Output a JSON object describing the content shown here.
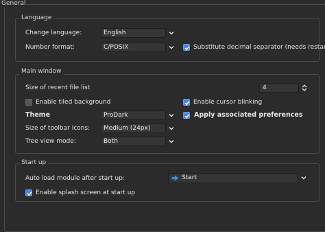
{
  "general": {
    "title": "General",
    "language_group": {
      "title": "Language",
      "change_language_label": "Change language:",
      "change_language_value": "English",
      "number_format_label": "Number format:",
      "number_format_value": "C/POSIX",
      "substitute_label": "Substitute decimal separator (needs restart)",
      "substitute_checked": true
    },
    "main_window_group": {
      "title": "Main window",
      "recent_files_label": "Size of recent file list",
      "recent_files_value": "4",
      "tiled_background_label": "Enable tiled background",
      "tiled_background_checked": false,
      "cursor_blinking_label": "Enable cursor blinking",
      "cursor_blinking_checked": true,
      "theme_label": "Theme",
      "theme_value": "ProDark",
      "associated_prefs_label": "Apply associated preferences",
      "associated_prefs_checked": true,
      "toolbar_icons_label": "Size of toolbar icons:",
      "toolbar_icons_value": "Medium (24px)",
      "tree_view_label": "Tree view mode:",
      "tree_view_value": "Both"
    },
    "startup_group": {
      "title": "Start up",
      "autoload_label": "Auto load module after start up:",
      "autoload_value": "Start",
      "splash_label": "Enable splash screen at start up",
      "splash_checked": true
    }
  },
  "colors": {
    "background": "#2b2b2b",
    "checkbox_on": "#4d86d9",
    "start_icon": "#4d8fe0"
  }
}
